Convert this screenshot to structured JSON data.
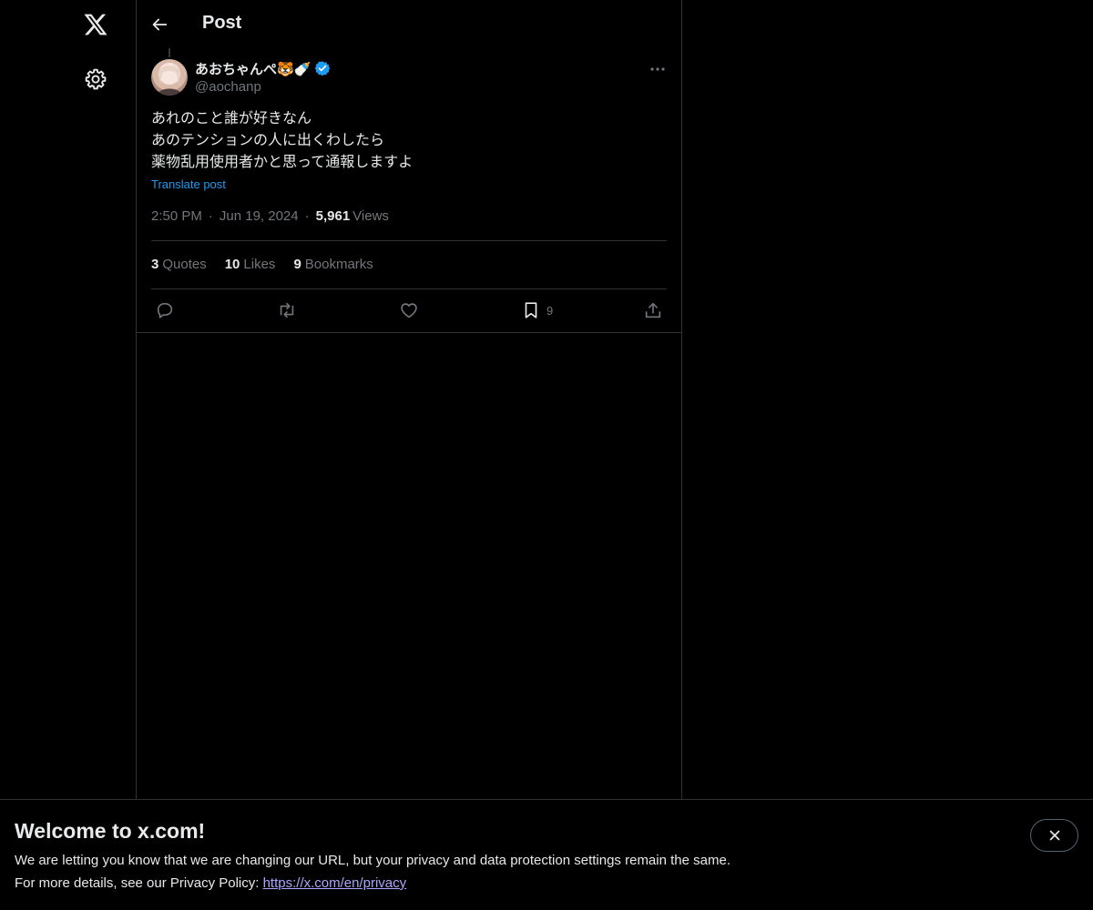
{
  "header": {
    "title": "Post"
  },
  "post": {
    "author_name": "あおちゃんぺ🐯🍼",
    "handle": "@aochanp",
    "lines": [
      "あれのこと誰が好きなん",
      "あのテンションの人に出くわしたら",
      "薬物乱用使用者かと思って通報しますよ"
    ],
    "translate_label": "Translate post",
    "time": "2:50 PM",
    "date": "Jun 19, 2024",
    "views_count": "5,961",
    "views_label": "Views",
    "separator": "·"
  },
  "stats": {
    "quotes_count": "3",
    "quotes_label": "Quotes",
    "likes_count": "10",
    "likes_label": "Likes",
    "bookmarks_count": "9",
    "bookmarks_label": "Bookmarks"
  },
  "actions": {
    "bookmark_count": "9"
  },
  "banner": {
    "title": "Welcome to x.com!",
    "line1": "We are letting you know that we are changing our URL, but your privacy and data protection settings remain the same.",
    "line2_prefix": "For more details, see our Privacy Policy: ",
    "link_text": "https://x.com/en/privacy"
  },
  "icons": {
    "logo": "x-logo-icon",
    "settings": "gear-icon",
    "back": "arrow-left-icon",
    "verified": "verified-badge-icon",
    "more": "more-horizontal-icon",
    "reply": "reply-icon",
    "repost": "repost-icon",
    "like": "heart-icon",
    "bookmark": "bookmark-icon",
    "share": "share-icon",
    "close": "close-icon"
  },
  "colors": {
    "background": "#000000",
    "accent": "#1d9bf0",
    "text": "#e7e9ea",
    "muted": "#71767b",
    "border": "#2f3336",
    "link": "#a9a6ff"
  }
}
